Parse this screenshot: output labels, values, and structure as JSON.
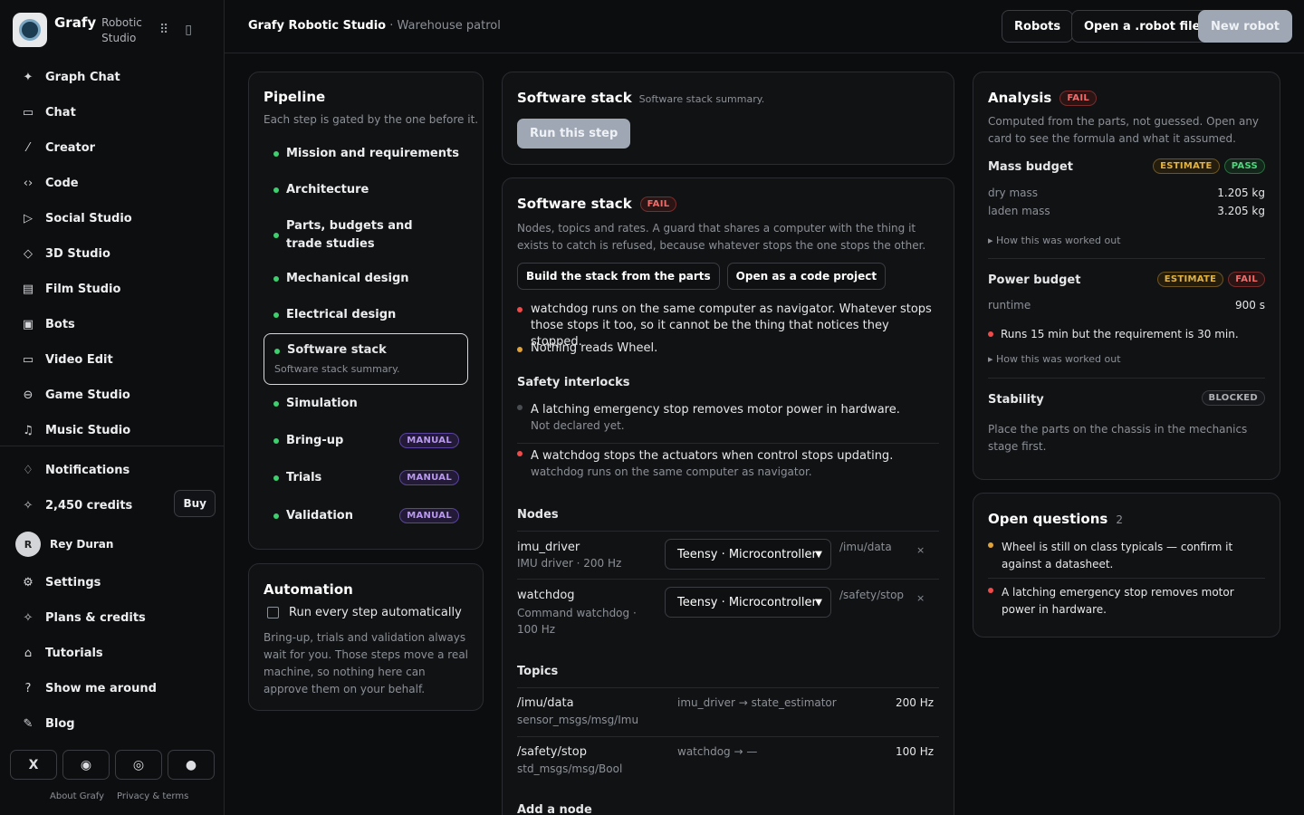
{
  "brand": {
    "name": "Grafy",
    "sub1": "Robotic",
    "sub2": "Studio"
  },
  "nav": [
    {
      "label": "Graph Chat",
      "icon": "sparkle-icon"
    },
    {
      "label": "Chat",
      "icon": "chat-icon"
    },
    {
      "label": "Creator",
      "icon": "wand-icon"
    },
    {
      "label": "Code",
      "icon": "code-icon"
    },
    {
      "label": "Social Studio",
      "icon": "send-icon"
    },
    {
      "label": "3D Studio",
      "icon": "cube-icon"
    },
    {
      "label": "Film Studio",
      "icon": "film-icon"
    },
    {
      "label": "Bots",
      "icon": "bot-icon"
    },
    {
      "label": "Video Edit",
      "icon": "video-icon"
    },
    {
      "label": "Game Studio",
      "icon": "gamepad-icon"
    },
    {
      "label": "Music Studio",
      "icon": "music-icon"
    }
  ],
  "account": {
    "notifications": "Notifications",
    "credits": "2,450 credits",
    "buy": "Buy",
    "user_initial": "R",
    "user_name": "Rey Duran",
    "settings": "Settings",
    "plans": "Plans & credits",
    "tutorials": "Tutorials",
    "tour": "Show me around",
    "blog": "Blog"
  },
  "footer": {
    "about": "About Grafy",
    "privacy": "Privacy & terms"
  },
  "topbar": {
    "app": "Grafy Robotic Studio",
    "sep": " · ",
    "project": "Warehouse patrol",
    "robots": "Robots",
    "open_file": "Open a .robot file",
    "new_robot": "New robot"
  },
  "pipeline": {
    "title": "Pipeline",
    "subtitle": "Each step is gated by the one before it.",
    "steps": [
      {
        "label": "Mission and requirements"
      },
      {
        "label": "Architecture"
      },
      {
        "label": "Parts, budgets and trade studies"
      },
      {
        "label": "Mechanical design"
      },
      {
        "label": "Electrical design"
      },
      {
        "label": "Software stack",
        "sub": "Software stack summary."
      },
      {
        "label": "Simulation"
      },
      {
        "label": "Bring-up",
        "badge": "MANUAL"
      },
      {
        "label": "Trials",
        "badge": "MANUAL"
      },
      {
        "label": "Validation",
        "badge": "MANUAL"
      }
    ]
  },
  "automation": {
    "title": "Automation",
    "checkbox_label": "Run every step automatically",
    "checked": false,
    "note": "Bring-up, trials and validation always wait for you. Those steps move a real machine, so nothing here can approve them on your behalf."
  },
  "summary_card": {
    "title": "Software stack",
    "subtitle": "Software stack summary.",
    "run": "Run this step"
  },
  "stack": {
    "title": "Software stack",
    "status": "FAIL",
    "desc": "Nodes, topics and rates. A guard that shares a computer with the thing it exists to catch is refused, because whatever stops the one stops the other.",
    "build": "Build the stack from the parts",
    "open_code": "Open as a code project",
    "issues": [
      {
        "severity": "red",
        "text": "watchdog runs on the same computer as navigator. Whatever stops those stops it too, so it cannot be the thing that notices they stopped."
      },
      {
        "severity": "amber",
        "text": "Nothing reads Wheel."
      }
    ],
    "interlocks_title": "Safety interlocks",
    "interlocks": [
      {
        "severity": "grey",
        "text": "A latching emergency stop removes motor power in hardware.",
        "sub": "Not declared yet."
      },
      {
        "severity": "red",
        "text": "A watchdog stops the actuators when control stops updating.",
        "sub": "watchdog runs on the same computer as navigator."
      }
    ],
    "nodes_title": "Nodes",
    "nodes": [
      {
        "name": "imu_driver",
        "desc": "IMU driver · 200 Hz",
        "computer": "Teensy · Microcontroller",
        "topic": "/imu/data"
      },
      {
        "name": "watchdog",
        "desc": "Command watchdog · 100 Hz",
        "computer": "Teensy · Microcontroller",
        "topic": "/safety/stop"
      }
    ],
    "topics_title": "Topics",
    "topics": [
      {
        "name": "/imu/data",
        "type": "sensor_msgs/msg/Imu",
        "flow": "imu_driver → state_estimator",
        "rate": "200 Hz"
      },
      {
        "name": "/safety/stop",
        "type": "std_msgs/msg/Bool",
        "flow": "watchdog → —",
        "rate": "100 Hz"
      }
    ],
    "add_node": "Add a node"
  },
  "analysis": {
    "title": "Analysis",
    "status": "FAIL",
    "desc": "Computed from the parts, not guessed. Open any card to see the formula and what it assumed.",
    "mass": {
      "title": "Mass budget",
      "badge1": "ESTIMATE",
      "badge2": "PASS",
      "dry_label": "dry mass",
      "dry_value": "1.205 kg",
      "laden_label": "laden mass",
      "laden_value": "3.205 kg",
      "how": "How this was worked out"
    },
    "power": {
      "title": "Power budget",
      "badge1": "ESTIMATE",
      "badge2": "FAIL",
      "runtime_label": "runtime",
      "runtime_value": "900 s",
      "issue": "Runs 15 min but the requirement is 30 min.",
      "how": "How this was worked out"
    },
    "stability": {
      "title": "Stability",
      "badge": "BLOCKED",
      "desc": "Place the parts on the chassis in the mechanics stage first."
    }
  },
  "questions": {
    "title": "Open questions",
    "count": "2",
    "items": [
      {
        "severity": "amber",
        "text": "Wheel is still on class typicals — confirm it against a datasheet."
      },
      {
        "severity": "red",
        "text": "A latching emergency stop removes motor power in hardware."
      }
    ]
  }
}
